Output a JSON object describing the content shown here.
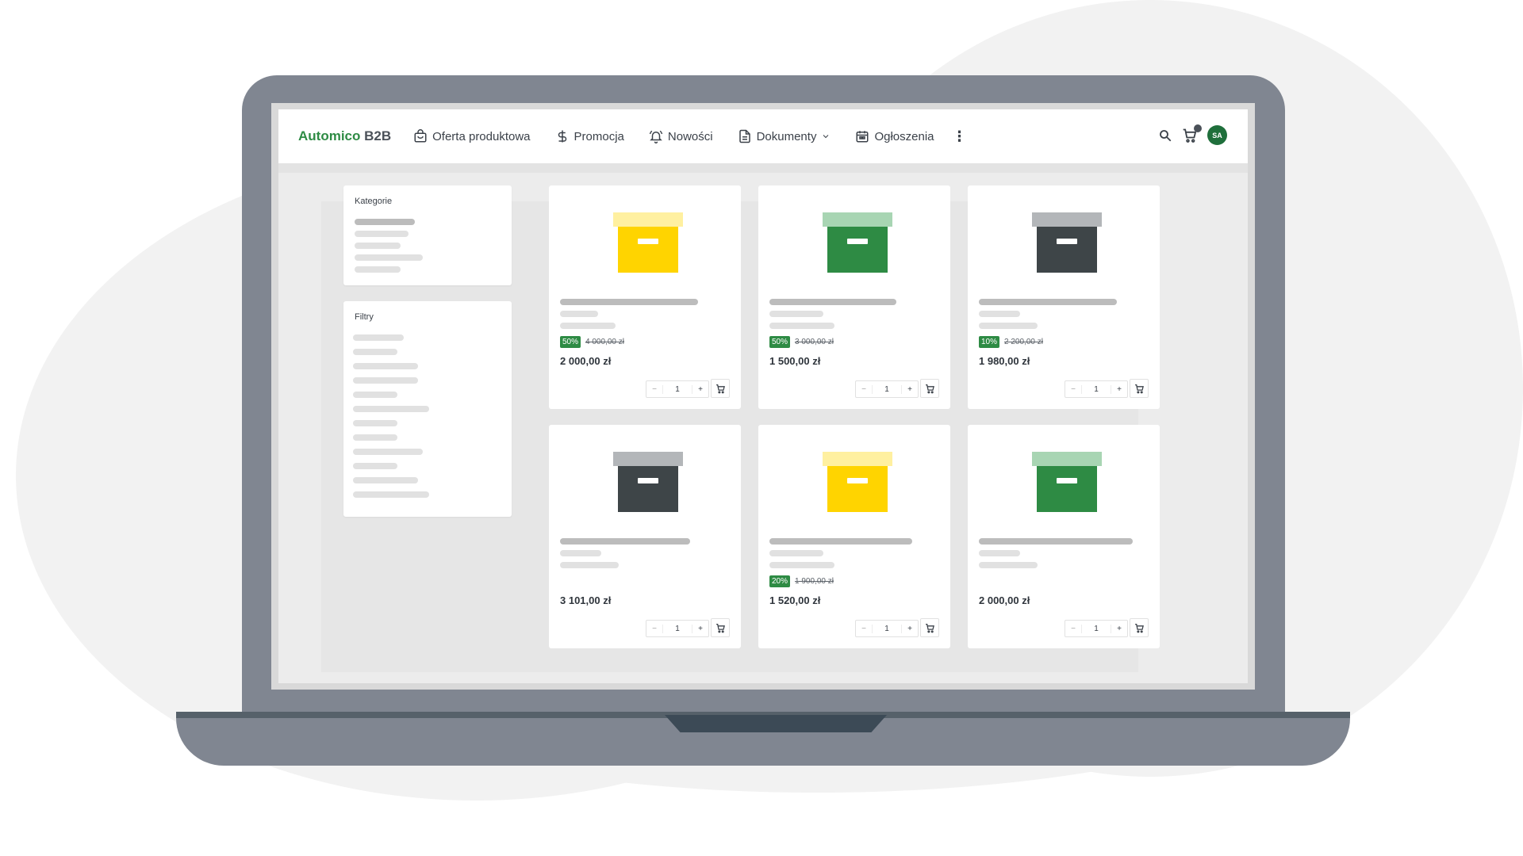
{
  "app": {
    "logo_brand": "Automico",
    "logo_suffix": " B2B"
  },
  "nav": {
    "items": [
      {
        "label": "Oferta produktowa",
        "icon": "bag-icon"
      },
      {
        "label": "Promocja",
        "icon": "dollar-icon"
      },
      {
        "label": "Nowości",
        "icon": "bell-icon"
      },
      {
        "label": "Dokumenty",
        "icon": "document-icon"
      },
      {
        "label": "Ogłoszenia",
        "icon": "calendar-icon"
      }
    ],
    "more_icon": "kebab-icon",
    "search_icon": "search-icon",
    "cart_icon": "cart-icon",
    "avatar_initials": "SA"
  },
  "sidebar": {
    "categories_title": "Kategorie",
    "filters_title": "Filtry"
  },
  "colors": {
    "brand_green": "#2e8b44",
    "box_yellow": "#ffd400",
    "box_yellow_lid": "#fff0a0",
    "box_green": "#2e8b44",
    "box_green_lid": "#a8d5b3",
    "box_dark": "#3e4548",
    "box_dark_lid": "#b3b6b9"
  },
  "products": [
    {
      "color": "yellow",
      "discount": "50%",
      "old_price": "4 000,00 zł",
      "price": "2 000,00 zł",
      "qty": "1"
    },
    {
      "color": "green",
      "discount": "50%",
      "old_price": "3 000,00 zł",
      "price": "1 500,00 zł",
      "qty": "1"
    },
    {
      "color": "dark",
      "discount": "10%",
      "old_price": "2 200,00 zł",
      "price": "1 980,00 zł",
      "qty": "1"
    },
    {
      "color": "dark",
      "discount": "",
      "old_price": "",
      "price": "3 101,00 zł",
      "qty": "1"
    },
    {
      "color": "yellow",
      "discount": "20%",
      "old_price": "1 900,00 zł",
      "price": "1 520,00 zł",
      "qty": "1"
    },
    {
      "color": "green",
      "discount": "",
      "old_price": "",
      "price": "2 000,00 zł",
      "qty": "1"
    }
  ]
}
